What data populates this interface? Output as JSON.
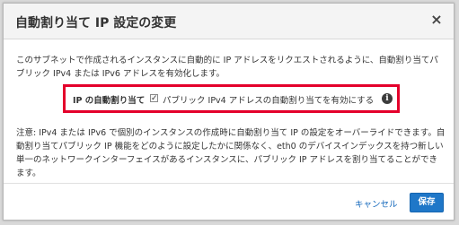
{
  "dialog": {
    "title": "自動割り当て IP 設定の変更",
    "close_label": "×",
    "description": "このサブネットで作成されるインスタンスに自動的に IP アドレスをリクエストされるように、自動割り当てパブリック IPv4 または IPv6 アドレスを有効化します。",
    "setting_label": "IP の自動割り当て",
    "checkbox_checked": true,
    "checkbox_mark": "✓",
    "checkbox_label": "パブリック IPv4 アドレスの自動割り当てを有効にする",
    "info_label": "i",
    "note": "注意: IPv4 または IPv6 で個別のインスタンスの作成時に自動割り当て IP の設定をオーバーライドできます。自動割り当てパブリック IP 機能をどのように設定したかに関係なく、eth0 のデバイスインデックスを持つ新しい単一のネットワークインターフェイスがあるインスタンスに、パブリック IP アドレスを割り当てることができます。",
    "cancel_label": "キャンセル",
    "save_label": "保存",
    "colors": {
      "highlight_border": "#e4002b",
      "primary_button": "#1f77c8",
      "link": "#1166bb"
    }
  }
}
